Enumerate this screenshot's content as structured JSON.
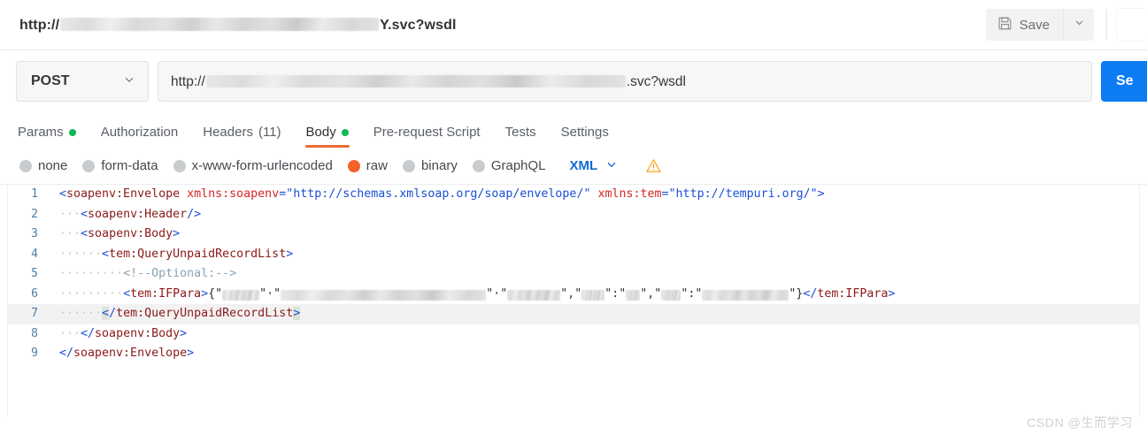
{
  "titlebar": {
    "url_prefix": "http://",
    "url_redacted": true,
    "url_suffix": "Y.svc?wsdl",
    "save_label": "Save",
    "save_icon": "floppy-disk-icon",
    "save_caret_icon": "chevron-down-icon"
  },
  "request": {
    "method": "POST",
    "method_caret_icon": "chevron-down-icon",
    "url_prefix": "http://",
    "url_redacted": true,
    "url_suffix": ".svc?wsdl",
    "send_label": "Se"
  },
  "tabs": [
    {
      "label": "Params",
      "dot": true,
      "count": "",
      "active": false
    },
    {
      "label": "Authorization",
      "dot": false,
      "count": "",
      "active": false
    },
    {
      "label": "Headers",
      "dot": false,
      "count": "(11)",
      "active": false
    },
    {
      "label": "Body",
      "dot": true,
      "count": "",
      "active": true
    },
    {
      "label": "Pre-request Script",
      "dot": false,
      "count": "",
      "active": false
    },
    {
      "label": "Tests",
      "dot": false,
      "count": "",
      "active": false
    },
    {
      "label": "Settings",
      "dot": false,
      "count": "",
      "active": false
    }
  ],
  "body_types": [
    {
      "label": "none",
      "selected": false
    },
    {
      "label": "form-data",
      "selected": false
    },
    {
      "label": "x-www-form-urlencoded",
      "selected": false
    },
    {
      "label": "raw",
      "selected": true
    },
    {
      "label": "binary",
      "selected": false
    },
    {
      "label": "GraphQL",
      "selected": false
    }
  ],
  "format_select": {
    "label": "XML",
    "caret_icon": "chevron-down-icon",
    "warning_icon": "warning-triangle-icon"
  },
  "editor": {
    "active_line": 7,
    "lines": [
      {
        "n": "1",
        "text": "<soapenv:Envelope xmlns:soapenv=\"http://schemas.xmlsoap.org/soap/envelope/\" xmlns:tem=\"http://tempuri.org/\">"
      },
      {
        "n": "2",
        "text": "   <soapenv:Header/>"
      },
      {
        "n": "3",
        "text": "   <soapenv:Body>"
      },
      {
        "n": "4",
        "text": "      <tem:QueryUnpaidRecordList>"
      },
      {
        "n": "5",
        "text": "         <!--Optional:-->"
      },
      {
        "n": "6",
        "text": "         <tem:IFPara>{\"....\":\"....\"}</tem:IFPara>"
      },
      {
        "n": "7",
        "text": "      </tem:QueryUnpaidRecordList>"
      },
      {
        "n": "8",
        "text": "   </soapenv:Body>"
      },
      {
        "n": "9",
        "text": "</soapenv:Envelope>"
      }
    ]
  },
  "colors": {
    "accent_orange": "#ef6a34",
    "send_blue": "#0d7cf2",
    "dot_green": "#0cbb52",
    "radio_selected": "#f4622a",
    "link_blue": "#1469d6",
    "warning": "#f5a623"
  },
  "watermark": "CSDN @生而学习"
}
